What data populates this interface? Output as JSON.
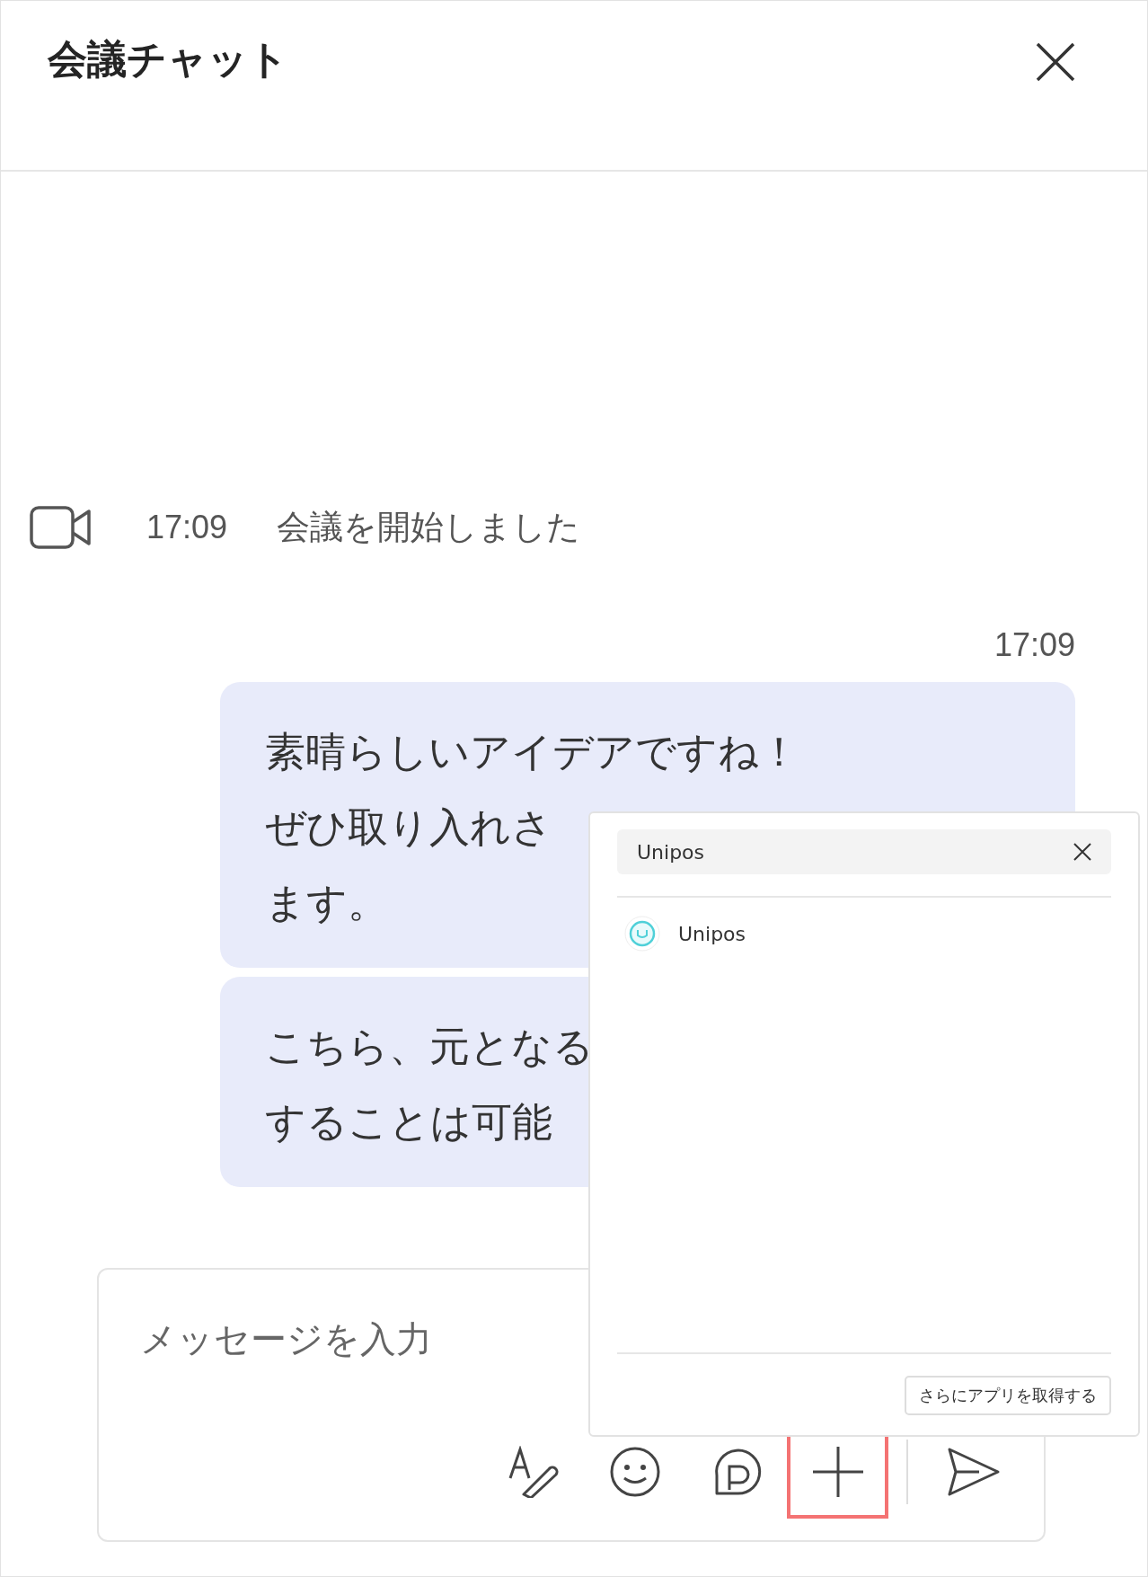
{
  "header": {
    "title": "会議チャット"
  },
  "events": [
    {
      "kind": "meeting_started",
      "time": "17:09",
      "text": "会議を開始しました"
    }
  ],
  "messages": [
    {
      "time": "17:09",
      "bubbles": [
        {
          "lines": [
            "素晴らしいアイデアですね！",
            "ぜひ取り入れさ",
            "ます。"
          ]
        },
        {
          "lines": [
            "こちら、元となる",
            "することは可能"
          ]
        }
      ]
    }
  ],
  "compose": {
    "placeholder": "メッセージを入力",
    "tools": [
      {
        "kind": "format",
        "highlighted": false
      },
      {
        "kind": "emoji",
        "highlighted": false
      },
      {
        "kind": "loop",
        "highlighted": false
      },
      {
        "kind": "add",
        "highlighted": true
      },
      {
        "kind": "send",
        "highlighted": false
      }
    ]
  },
  "app_popup": {
    "search": {
      "value": "Unipos"
    },
    "apps": [
      {
        "name": "Unipos"
      }
    ],
    "more_button": "さらにアプリを取得する"
  }
}
